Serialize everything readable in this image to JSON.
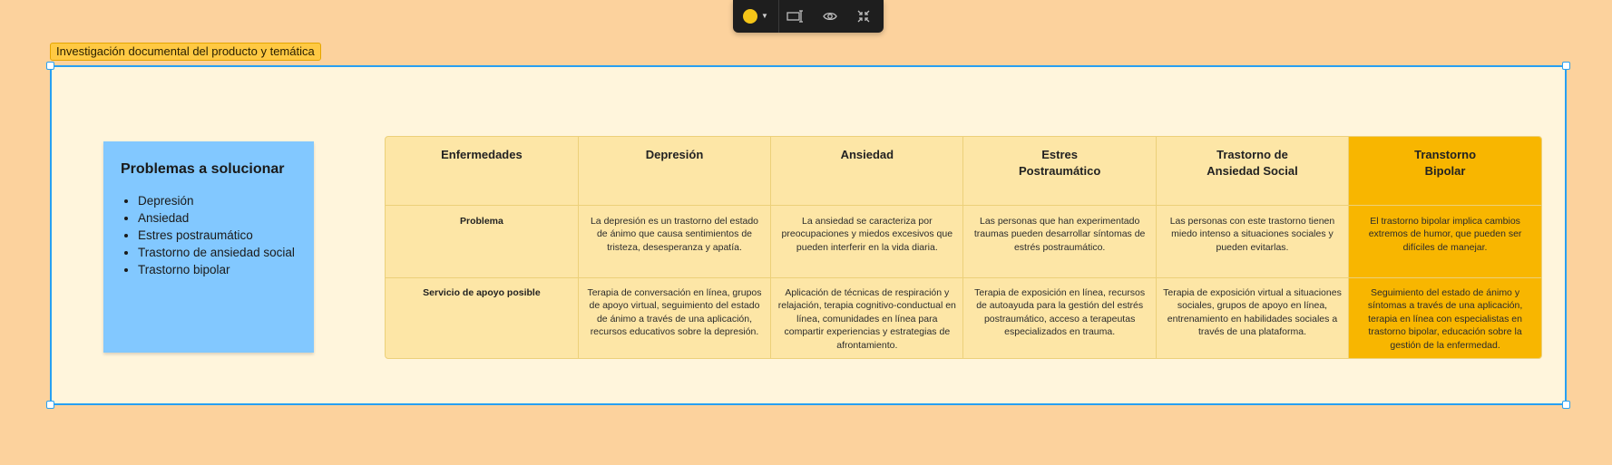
{
  "toolbar": {
    "color_swatch": "#f5c518",
    "icons": [
      "color-picker",
      "text-rename-icon",
      "eye-icon",
      "collapse-icon"
    ]
  },
  "section": {
    "title": "Investigación documental del producto y temática",
    "accent": "#27a0f2",
    "background": "#fff5dc"
  },
  "sticky": {
    "title": "Problemas a solucionar",
    "color": "#82c8ff",
    "items": [
      "Depresión",
      "Ansiedad",
      "Estres postraumático",
      "Trastorno de ansiedad social",
      "Trastorno bipolar"
    ]
  },
  "table": {
    "highlight_color": "#f8b600",
    "headers": [
      [
        "Enfermedades"
      ],
      [
        "Depresión"
      ],
      [
        "Ansiedad"
      ],
      [
        "Estres",
        "Postraumático"
      ],
      [
        "Trastorno de",
        "Ansiedad Social"
      ],
      [
        "Transtorno",
        "Bipolar"
      ]
    ],
    "rows": [
      {
        "label": "Problema",
        "cells": [
          "La depresión es un trastorno del estado de ánimo que causa sentimientos de tristeza, desesperanza y apatía.",
          "La ansiedad se caracteriza por preocupaciones y miedos excesivos que pueden interferir en la vida diaria.",
          "Las personas que han experimentado traumas pueden desarrollar síntomas de estrés postraumático.",
          "Las personas con este trastorno tienen miedo intenso a situaciones sociales y pueden evitarlas.",
          "El trastorno bipolar implica cambios extremos de humor, que pueden ser difíciles de manejar."
        ]
      },
      {
        "label": "Servicio de apoyo posible",
        "cells": [
          "Terapia de conversación en línea, grupos de apoyo virtual, seguimiento del estado de ánimo a través de una aplicación, recursos educativos sobre la depresión.",
          "Aplicación de técnicas de respiración y relajación, terapia cognitivo-conductual en línea, comunidades en línea para compartir experiencias y estrategias de afrontamiento.",
          "Terapia de exposición en línea, recursos de autoayuda para la gestión del estrés postraumático, acceso a terapeutas especializados en trauma.",
          "Terapia de exposición virtual a situaciones sociales, grupos de apoyo en línea, entrenamiento en habilidades sociales a través de una plataforma.",
          "Seguimiento del estado de ánimo y síntomas a través de una aplicación, terapia en línea con especialistas en trastorno bipolar, educación sobre la gestión de la enfermedad."
        ]
      }
    ]
  }
}
